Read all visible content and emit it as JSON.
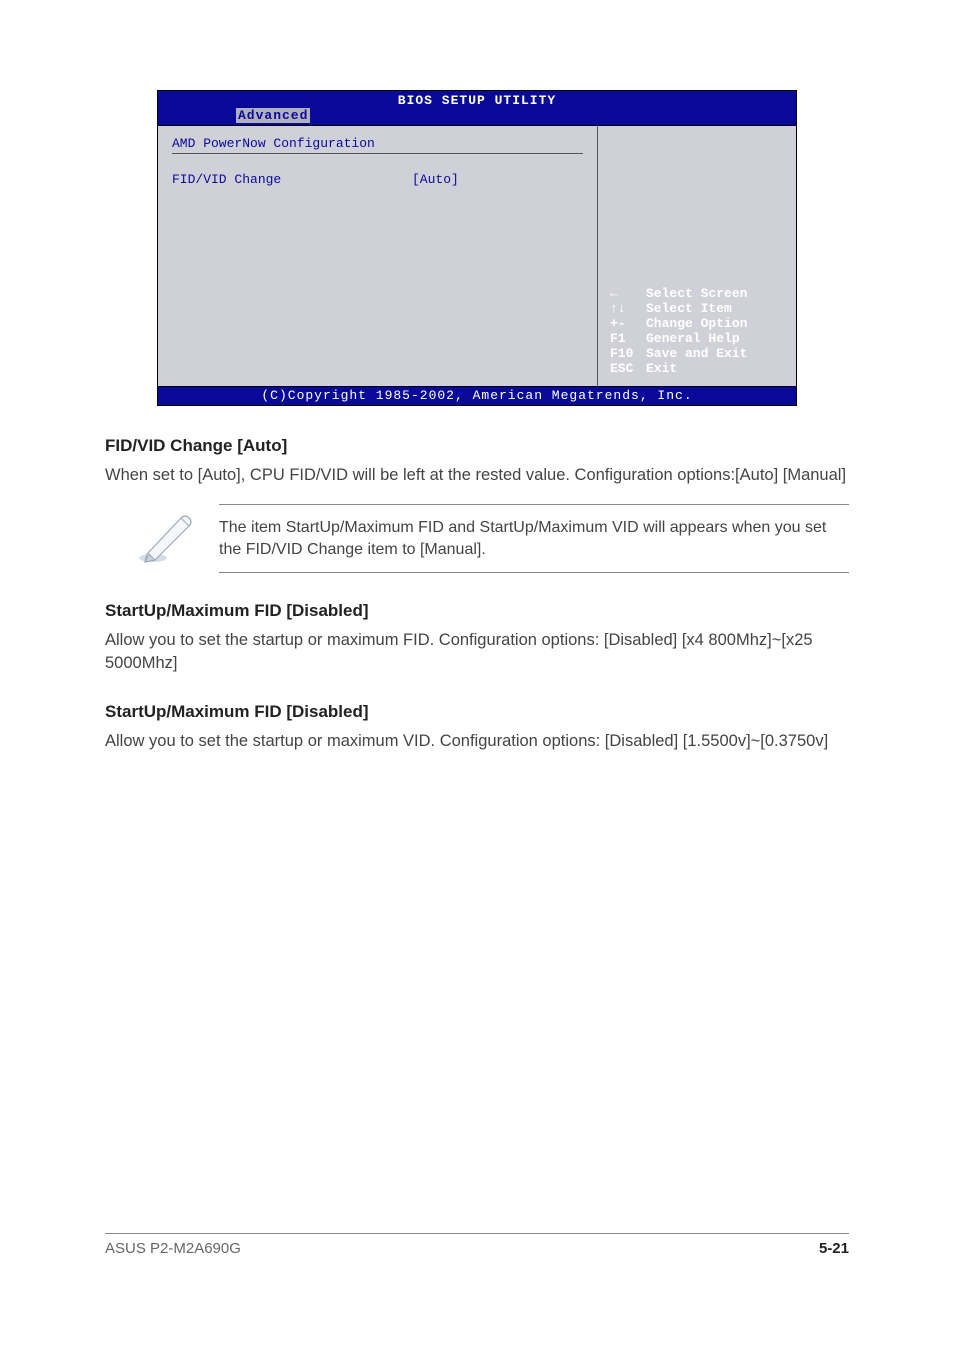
{
  "bios": {
    "title": "BIOS SETUP UTILITY",
    "active_tab": "Advanced",
    "section_title": "AMD PowerNow Configuration",
    "setting": {
      "label": "FID/VID Change",
      "value": "[Auto]"
    },
    "key_help": [
      {
        "key": "←",
        "icon": "arrow-left-icon",
        "action": "Select Screen"
      },
      {
        "key": "↑↓",
        "icon": "arrows-updown-icon",
        "action": "Select Item"
      },
      {
        "key": "+-",
        "icon": "plusminus-icon",
        "action": "Change Option"
      },
      {
        "key": "F1",
        "icon": "",
        "action": "General Help"
      },
      {
        "key": "F10",
        "icon": "",
        "action": "Save and Exit"
      },
      {
        "key": "ESC",
        "icon": "",
        "action": "Exit"
      }
    ],
    "copyright": "(C)Copyright 1985-2002, American Megatrends, Inc."
  },
  "doc": {
    "h1": {
      "title": "FID/VID Change [Auto]",
      "body": "When set to [Auto], CPU FID/VID will be left at the rested value. Configuration options:[Auto] [Manual]"
    },
    "note": "The item StartUp/Maximum FID and StartUp/Maximum VID will appears when you set the FID/VID Change item to [Manual].",
    "h2": {
      "title": "StartUp/Maximum FID [Disabled]",
      "body": "Allow you to set the startup or maximum FID. Configuration options: [Disabled] [x4 800Mhz]~[x25 5000Mhz]"
    },
    "h3": {
      "title": "StartUp/Maximum FID [Disabled]",
      "body": "Allow you to set the startup or maximum VID. Configuration options: [Disabled] [1.5500v]~[0.3750v]"
    }
  },
  "footer": {
    "product": "ASUS P2-M2A690G",
    "page": "5-21"
  }
}
